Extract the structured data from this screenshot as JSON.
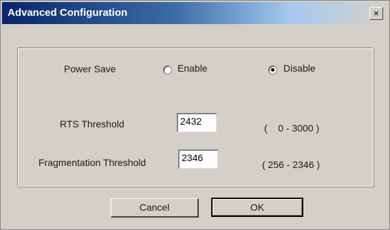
{
  "window": {
    "title": "Advanced Configuration",
    "close_glyph": "×"
  },
  "power_save": {
    "label": "Power Save",
    "options": [
      {
        "label": "Enable",
        "checked": false
      },
      {
        "label": "Disable",
        "checked": true
      }
    ]
  },
  "rts": {
    "label": "RTS Threshold",
    "value": "2432",
    "range": "(    0 - 3000 )"
  },
  "fragmentation": {
    "label": "Fragmentation Threshold",
    "value": "2346",
    "range": "( 256 - 2346 )"
  },
  "buttons": {
    "cancel": "Cancel",
    "ok": "OK"
  }
}
